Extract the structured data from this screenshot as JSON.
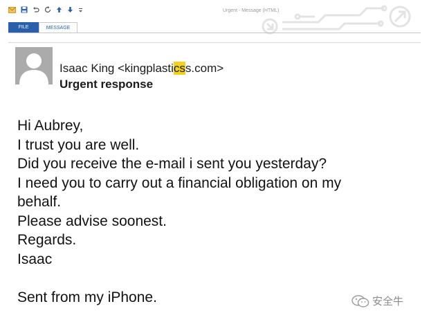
{
  "window": {
    "title": "Urgent - Message (HTML)"
  },
  "quick_access": [
    {
      "icon": "envelope-icon",
      "color": "#e2a73a"
    },
    {
      "icon": "save-icon",
      "color": "#2a5fac"
    },
    {
      "icon": "undo-icon",
      "color": "#555555"
    },
    {
      "icon": "redo-icon",
      "color": "#555555"
    },
    {
      "icon": "arrow-up-icon",
      "color": "#2a5fac"
    },
    {
      "icon": "arrow-down-icon",
      "color": "#2a5fac"
    },
    {
      "icon": "customize-icon",
      "color": "#555555"
    }
  ],
  "ribbon": {
    "tabs": [
      {
        "label": "FILE",
        "active": false
      },
      {
        "label": "MESSAGE",
        "active": true
      }
    ]
  },
  "header": {
    "sender_name_prefix": "Isaac King <kingplasti",
    "sender_highlight": "cs",
    "sender_suffix": "s.com>",
    "subject": "Urgent response",
    "highlight_color": "#f2d21c"
  },
  "body": {
    "lines": [
      "Hi Aubrey,",
      "I trust you are well.",
      "Did you receive the e-mail i sent you yesterday?",
      "I need you to carry out a financial obligation on my",
      "behalf.",
      "Please advise soonest.",
      "Regards.",
      "Isaac"
    ],
    "signature": "Sent from my iPhone."
  },
  "watermark": {
    "text": "安全牛"
  },
  "colors": {
    "file_tab": "#2a5fac",
    "tab_text": "#2a5fac"
  }
}
